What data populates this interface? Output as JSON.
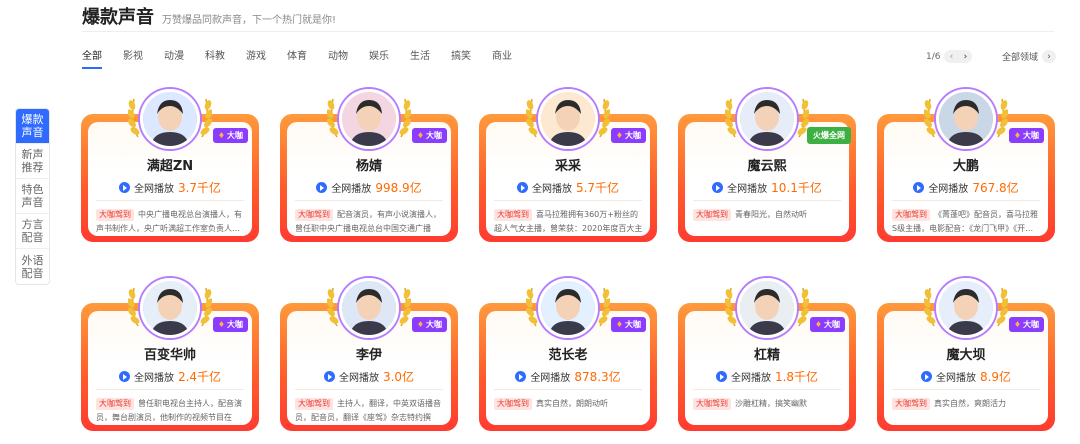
{
  "header": {
    "title": "爆款声音",
    "subtitle": "万赞爆品同款声音，下一个热门就是你!"
  },
  "sidenav": [
    {
      "label": "爆款\n声音",
      "active": true
    },
    {
      "label": "新声\n推荐",
      "active": false
    },
    {
      "label": "特色\n声音",
      "active": false
    },
    {
      "label": "方言\n配音",
      "active": false
    },
    {
      "label": "外语\n配音",
      "active": false
    }
  ],
  "tabs": [
    "全部",
    "影视",
    "动漫",
    "科教",
    "游戏",
    "体育",
    "动物",
    "娱乐",
    "生活",
    "搞笑",
    "商业"
  ],
  "pager": {
    "text": "1/6",
    "prev": "‹",
    "next": "›"
  },
  "all_fields": {
    "label": "全部领域",
    "arrow": "›"
  },
  "plays_label": "全网播放",
  "badge_label": "大咖",
  "cards": [
    {
      "name": "满超ZN",
      "value": "3.7千亿",
      "tag": "大咖驾到",
      "desc": "中央广播电视总台演播人，有声书制作人，央广听满超工作室负责人…",
      "badge": "大咖",
      "avatar_color": "#dbe8ff",
      "avatar_icon": "cartoon-boy"
    },
    {
      "name": "杨婧",
      "value": "998.9亿",
      "tag": "大咖驾到",
      "desc": "配音演员，有声小说演播人，曾任职中央广播电视总台中国交通广播《…",
      "badge": "大咖",
      "avatar_color": "#f3d6e1",
      "avatar_icon": "woman"
    },
    {
      "name": "采采",
      "value": "5.7千亿",
      "tag": "大咖驾到",
      "desc": "喜马拉雅拥有360万+粉丝的超人气女主播，曾荣获：2020年度百大主播…",
      "badge": "大咖",
      "avatar_color": "#fde9d2",
      "avatar_icon": "cartoon-girl"
    },
    {
      "name": "魔云熙",
      "value": "10.1千亿",
      "tag": "大咖驾到",
      "desc": "青春阳光，自然动听",
      "badge": "火爆全网",
      "avatar_color": "#e6ecf8",
      "avatar_icon": "man"
    },
    {
      "name": "大鹏",
      "value": "767.8亿",
      "tag": "大咖驾到",
      "desc": "《菁蓬吧》配音员，喜马拉雅S级主播，电影配音：《龙门飞甲》《开…",
      "badge": "大咖",
      "avatar_color": "#c9d7e6",
      "avatar_icon": "man-dark"
    },
    {
      "name": "百变华帅",
      "value": "2.4千亿",
      "tag": "大咖驾到",
      "desc": "曾任职电视台主持人，配音演员，舞台剧演员，他制作的视频节目在全…",
      "badge": "大咖",
      "avatar_color": "#e6eef8",
      "avatar_icon": "man-suit"
    },
    {
      "name": "李伊",
      "value": "3.0亿",
      "tag": "大咖驾到",
      "desc": "主持人，翻译，中英双语播音员，配音员，翻译《座驾》杂志特约撰稿…",
      "badge": "大咖",
      "avatar_color": "#dde7f5",
      "avatar_icon": "young-man"
    },
    {
      "name": "范长老",
      "value": "878.3亿",
      "tag": "大咖驾到",
      "desc": "真实自然，朗朗动听",
      "badge": "大咖",
      "avatar_color": "#e3f0ff",
      "avatar_icon": "cartoon-man"
    },
    {
      "name": "杠精",
      "value": "1.8千亿",
      "tag": "大咖驾到",
      "desc": "沙雕杠精，搞笑幽默",
      "badge": "大咖",
      "avatar_color": "#e9eef3",
      "avatar_icon": "old-man"
    },
    {
      "name": "魔大坝",
      "value": "8.9亿",
      "tag": "大咖驾到",
      "desc": "真实自然，爽朗活力",
      "badge": "大咖",
      "avatar_color": "#e6eefc",
      "avatar_icon": "young-man-2"
    }
  ]
}
